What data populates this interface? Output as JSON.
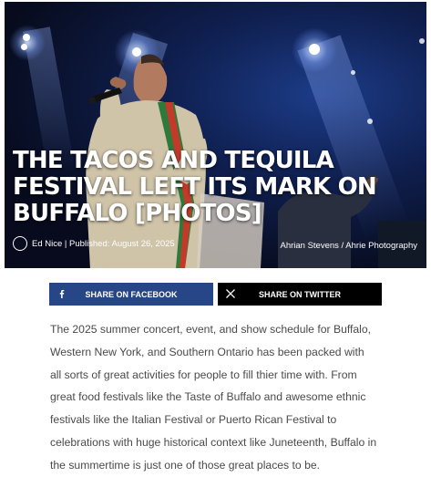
{
  "hero": {
    "headline": "THE TACOS AND TEQUILA FESTIVAL LEFT ITS MARK ON BUFFALO [PHOTOS]",
    "byline": "Ed Nice | Published: August 26, 2025",
    "photo_credit": "Ahrian Stevens / Ahrie Photography",
    "avatar_icon": "user-circle-icon"
  },
  "share": {
    "facebook_label": "SHARE ON FACEBOOK",
    "facebook_icon": "facebook-icon",
    "facebook_color": "#264687",
    "twitter_label": "SHARE ON TWITTER",
    "twitter_icon": "x-icon",
    "twitter_color": "#000000"
  },
  "article": {
    "paragraph": "The 2025 summer concert, event, and show schedule for Buffalo, Western New York, and Southern Ontario has been packed with all sorts of great activities for people to fill thier time with. From great food festivals like the Taste of Buffalo and awesome ethnic festivals like the Italian Festival or Puerto Rican Festival to celebrations with huge historical context like Juneteenth, Buffalo in the summertime is just one of those great places to be."
  }
}
